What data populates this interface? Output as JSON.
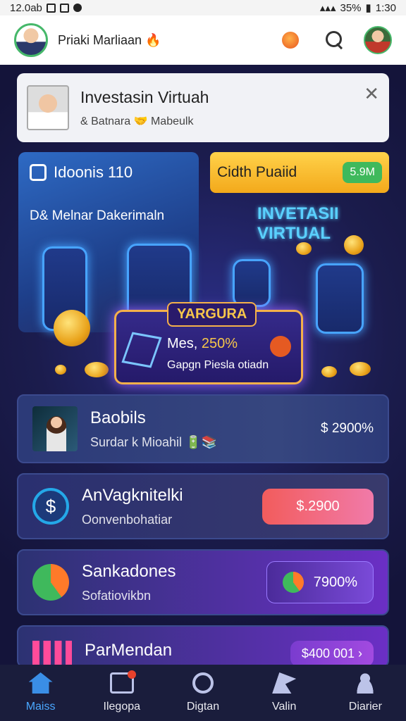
{
  "status_bar": {
    "left": "12.0ab",
    "right_pct": "35%",
    "time": "1:30"
  },
  "app_bar": {
    "title": "Priaki Marliaan",
    "flame": "🔥"
  },
  "notice": {
    "title": "Investasin Virtuah",
    "subtitle": "& Batnara 🤝 Mabeulk",
    "close": "✕"
  },
  "left_card": {
    "title": "Idoonis 110",
    "subtitle": "D& Melnar Dakerimaln"
  },
  "yellow_banner": {
    "label": "Cidth Puaiid",
    "tag": "5.9M"
  },
  "virtual_title": {
    "line1": "INVETASII",
    "line2": "VIRTUAL"
  },
  "promo": {
    "tag": "YARGURA",
    "pct_label": "Mes,",
    "pct_value": "250%",
    "sub": "Gapgn Piesla otiadn"
  },
  "rows": [
    {
      "title": "Baobils",
      "subtitle": "Surdar k Mioahil 🔋📚",
      "value": "$ 2900%"
    },
    {
      "title": "AnVagknitelki",
      "subtitle": "Oonvenbohatiar",
      "value": "$.2900"
    },
    {
      "title": "Sankadones",
      "subtitle": "Sofatiovikbn",
      "value": "7900%"
    },
    {
      "title": "ParMendan",
      "value": "$400 001 ›"
    }
  ],
  "tabs": [
    {
      "label": "Maiss",
      "icon": "home-icon"
    },
    {
      "label": "Ilegopa",
      "icon": "wallet-icon"
    },
    {
      "label": "Digtan",
      "icon": "chart-ring-icon"
    },
    {
      "label": "Valin",
      "icon": "flag-icon"
    },
    {
      "label": "Diarier",
      "icon": "user-icon"
    }
  ]
}
